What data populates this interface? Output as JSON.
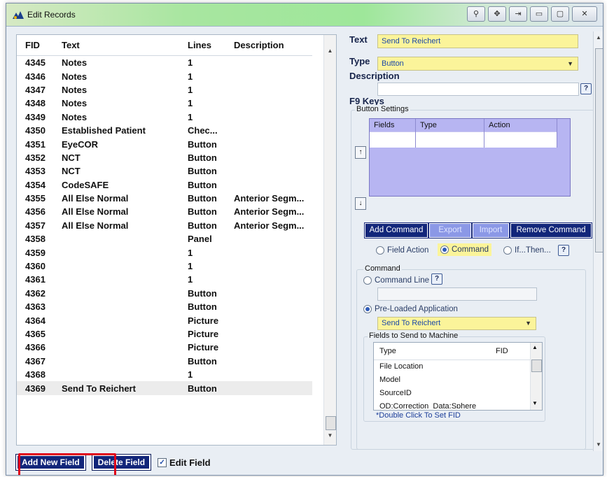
{
  "window": {
    "title": "Edit Records",
    "bg_menu_text": "Close"
  },
  "grid": {
    "headers": [
      "FID",
      "Text",
      "Lines",
      "Description"
    ],
    "rows": [
      {
        "fid": "4345",
        "text": "Notes",
        "lines": "1",
        "desc": ""
      },
      {
        "fid": "4346",
        "text": "Notes",
        "lines": "1",
        "desc": ""
      },
      {
        "fid": "4347",
        "text": "Notes",
        "lines": "1",
        "desc": ""
      },
      {
        "fid": "4348",
        "text": "Notes",
        "lines": "1",
        "desc": ""
      },
      {
        "fid": "4349",
        "text": "Notes",
        "lines": "1",
        "desc": ""
      },
      {
        "fid": "4350",
        "text": "Established Patient",
        "lines": "Chec...",
        "desc": ""
      },
      {
        "fid": "4351",
        "text": "EyeCOR",
        "lines": "Button",
        "desc": ""
      },
      {
        "fid": "4352",
        "text": "NCT",
        "lines": "Button",
        "desc": ""
      },
      {
        "fid": "4353",
        "text": "NCT",
        "lines": "Button",
        "desc": ""
      },
      {
        "fid": "4354",
        "text": "CodeSAFE",
        "lines": "Button",
        "desc": ""
      },
      {
        "fid": "4355",
        "text": "All Else Normal",
        "lines": "Button",
        "desc": "Anterior Segm..."
      },
      {
        "fid": "4356",
        "text": "All Else Normal",
        "lines": "Button",
        "desc": "Anterior Segm..."
      },
      {
        "fid": "4357",
        "text": "All Else Normal",
        "lines": "Button",
        "desc": "Anterior Segm..."
      },
      {
        "fid": "4358",
        "text": "",
        "lines": "Panel",
        "desc": ""
      },
      {
        "fid": "4359",
        "text": "",
        "lines": "1",
        "desc": ""
      },
      {
        "fid": "4360",
        "text": "",
        "lines": "1",
        "desc": ""
      },
      {
        "fid": "4361",
        "text": "",
        "lines": "1",
        "desc": ""
      },
      {
        "fid": "4362",
        "text": "",
        "lines": "Button",
        "desc": ""
      },
      {
        "fid": "4363",
        "text": "",
        "lines": "Button",
        "desc": ""
      },
      {
        "fid": "4364",
        "text": "",
        "lines": "Picture",
        "desc": ""
      },
      {
        "fid": "4365",
        "text": "",
        "lines": "Picture",
        "desc": ""
      },
      {
        "fid": "4366",
        "text": "",
        "lines": "Picture",
        "desc": ""
      },
      {
        "fid": "4367",
        "text": "",
        "lines": "Button",
        "desc": ""
      },
      {
        "fid": "4368",
        "text": "",
        "lines": "1",
        "desc": ""
      },
      {
        "fid": "4369",
        "text": "Send To Reichert",
        "lines": "Button",
        "desc": ""
      }
    ]
  },
  "bottom": {
    "add_new_field": "Add New Field",
    "delete_field": "Delete Field",
    "edit_field": "Edit Field"
  },
  "right": {
    "text_label": "Text",
    "text_value": "Send To Reichert",
    "type_label": "Type",
    "type_value": "Button",
    "description_label": "Description",
    "help": "?",
    "f9_keys": "F9 Keys",
    "button_settings": "Button Settings",
    "settings_headers": [
      "Fields",
      "Type",
      "Action"
    ],
    "up_arrow": "↑",
    "down_arrow": "↓",
    "add_command": "Add Command",
    "export": "Export",
    "import": "Import",
    "remove_command": "Remove Command",
    "radio_field_action": "Field Action",
    "radio_command": "Command",
    "radio_if_then": "If...Then...",
    "command_group": "Command",
    "command_line": "Command Line",
    "preloaded_app": "Pre-Loaded Application",
    "preloaded_value": "Send To Reichert",
    "fields_to_send": "Fields to Send to Machine",
    "fields_headers": [
      "Type",
      "FID"
    ],
    "fields_items": [
      "File Location",
      "Model",
      "SourceID",
      "OD:Correction_Data:Sphere"
    ],
    "double_click_hint": "*Double Click To Set FID"
  }
}
